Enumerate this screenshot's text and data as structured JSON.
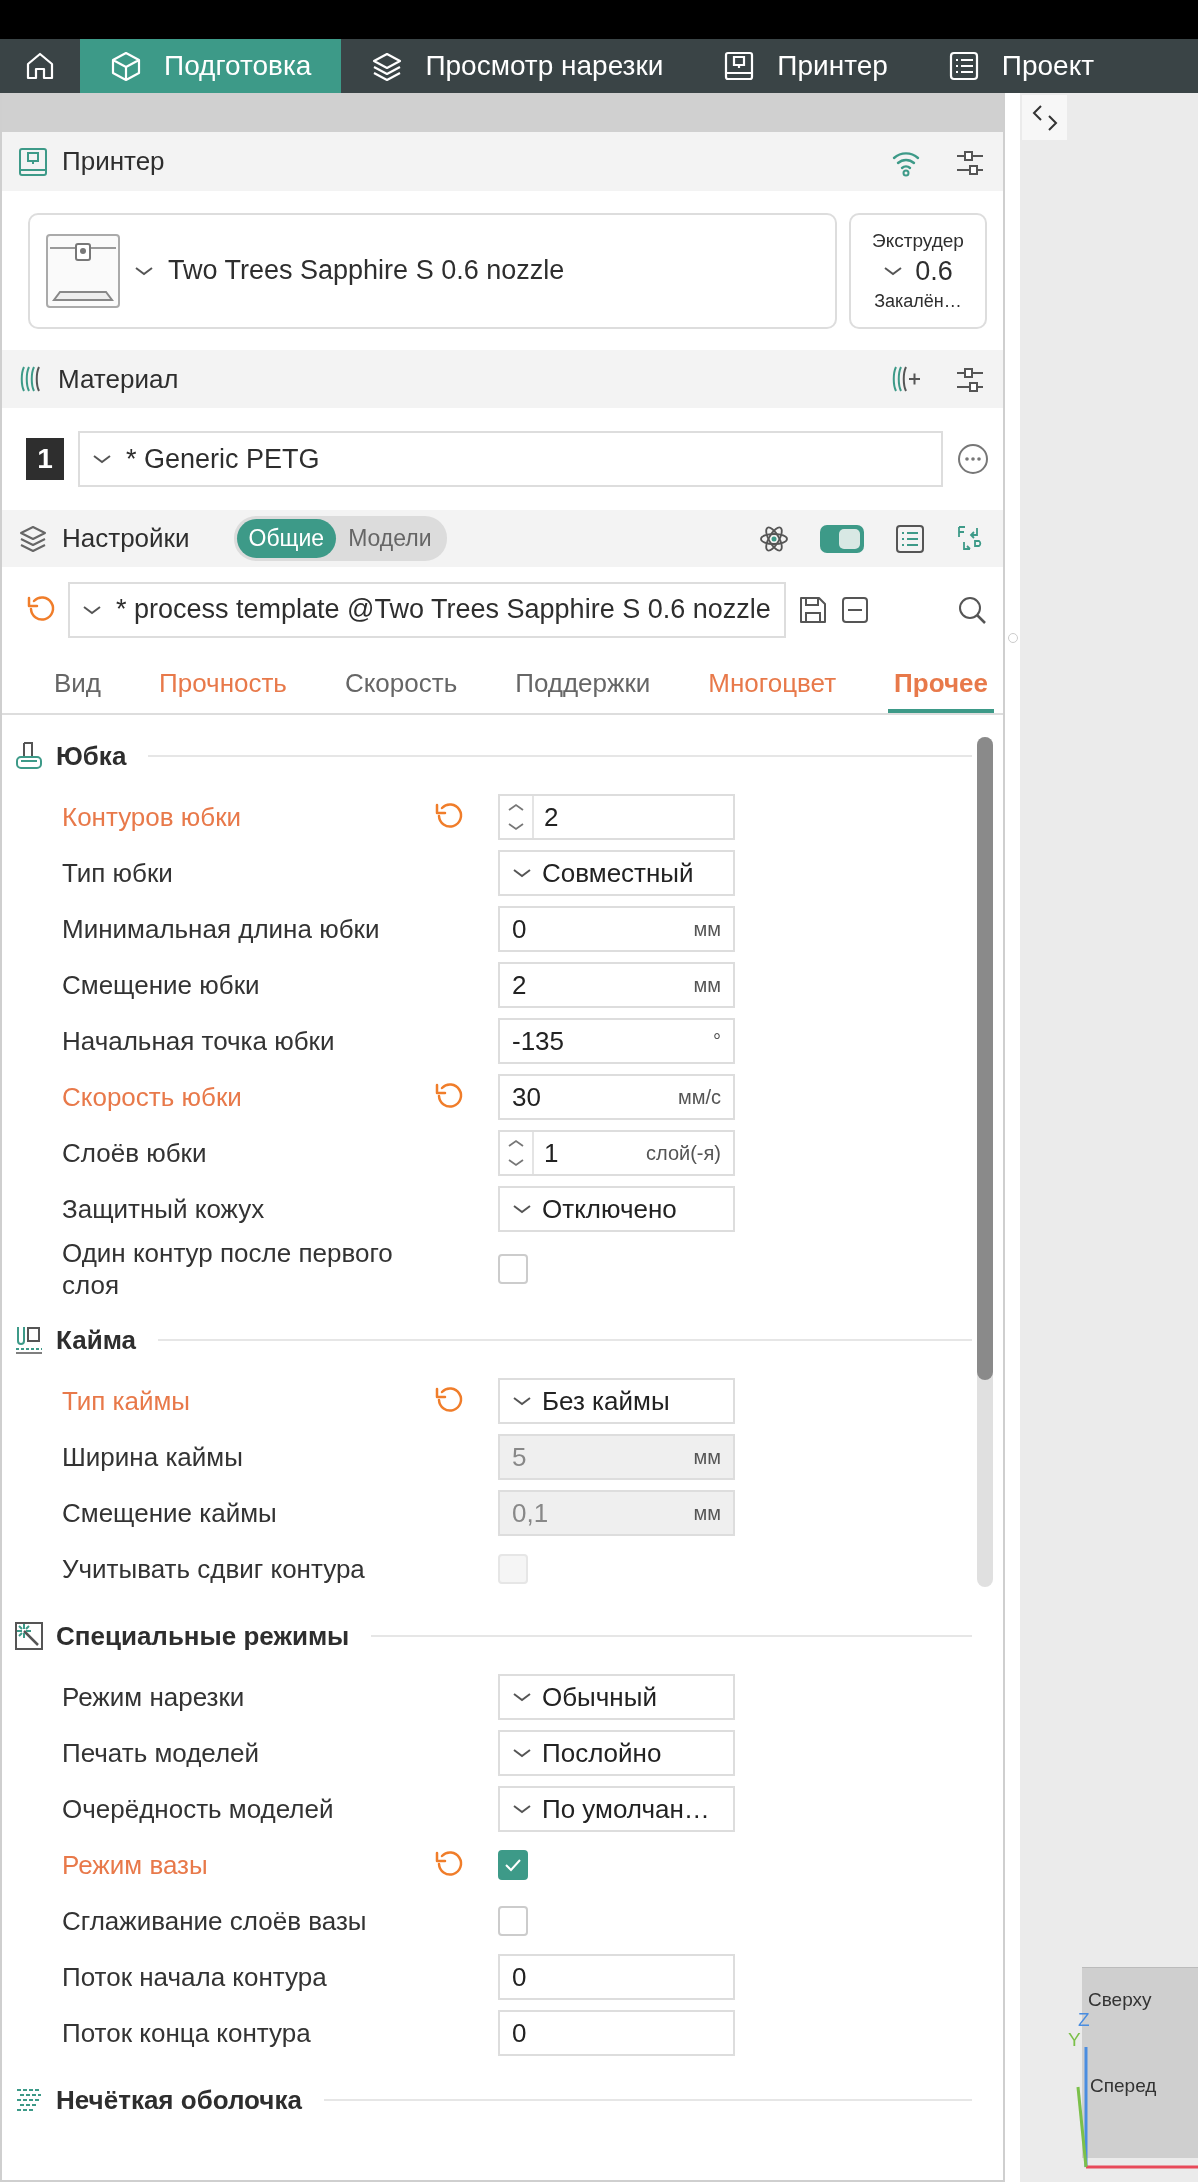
{
  "nav": {
    "tabs": [
      {
        "label": "Подготовка",
        "selected": true
      },
      {
        "label": "Просмотр нарезки",
        "selected": false
      },
      {
        "label": "Принтер",
        "selected": false
      },
      {
        "label": "Проект",
        "selected": false
      }
    ]
  },
  "printer": {
    "title": "Принтер",
    "name": "Two Trees Sapphire S 0.6 nozzle",
    "extruder": {
      "label": "Экструдер",
      "diameter": "0.6",
      "nozzle_type": "Закалён…"
    }
  },
  "material": {
    "title": "Материал",
    "filaments": [
      {
        "number": "1",
        "name": "* Generic PETG"
      }
    ]
  },
  "settings": {
    "title": "Настройки",
    "scope": [
      {
        "label": "Общие",
        "selected": true
      },
      {
        "label": "Модели",
        "selected": false
      }
    ],
    "advanced": true,
    "preset": {
      "name": "* process template @Two Trees Sapphire S 0.6 nozzle",
      "modified": true
    },
    "tabs": [
      {
        "label": "Вид",
        "selected": false,
        "modified": false
      },
      {
        "label": "Прочность",
        "selected": false,
        "modified": true
      },
      {
        "label": "Скорость",
        "selected": false,
        "modified": false
      },
      {
        "label": "Поддержки",
        "selected": false,
        "modified": false
      },
      {
        "label": "Многоцвет",
        "selected": false,
        "modified": true
      },
      {
        "label": "Прочее",
        "selected": true,
        "modified": true
      }
    ],
    "groups": [
      {
        "title": "Юбка",
        "options": [
          {
            "kind": "spinner",
            "label": "Контуров юбки",
            "value": "2",
            "modified": true,
            "disabled": false
          },
          {
            "kind": "dropdown",
            "label": "Тип юбки",
            "value": "Совместный",
            "modified": false,
            "disabled": false
          },
          {
            "kind": "input",
            "label": "Минимальная длина юбки",
            "value": "0",
            "unit": "мм",
            "modified": false,
            "disabled": false
          },
          {
            "kind": "input",
            "label": "Смещение юбки",
            "value": "2",
            "unit": "мм",
            "modified": false,
            "disabled": false
          },
          {
            "kind": "input",
            "label": "Начальная точка юбки",
            "value": "-135",
            "unit": "°",
            "modified": false,
            "disabled": false
          },
          {
            "kind": "input",
            "label": "Скорость юбки",
            "value": "30",
            "unit": "мм/с",
            "modified": true,
            "disabled": false
          },
          {
            "kind": "spinner",
            "label": "Слоёв юбки",
            "value": "1",
            "unit": "слой(-я)",
            "modified": false,
            "disabled": false
          },
          {
            "kind": "dropdown",
            "label": "Защитный кожух",
            "value": "Отключено",
            "modified": false,
            "disabled": false
          },
          {
            "kind": "checkbox",
            "label": "Один контур после первого слоя",
            "checked": false,
            "modified": false,
            "disabled": false
          }
        ]
      },
      {
        "title": "Кайма",
        "options": [
          {
            "kind": "dropdown",
            "label": "Тип каймы",
            "value": "Без каймы",
            "modified": true,
            "disabled": false
          },
          {
            "kind": "input",
            "label": "Ширина каймы",
            "value": "5",
            "unit": "мм",
            "modified": false,
            "disabled": true
          },
          {
            "kind": "input",
            "label": "Смещение каймы",
            "value": "0,1",
            "unit": "мм",
            "modified": false,
            "disabled": true
          },
          {
            "kind": "checkbox",
            "label": "Учитывать сдвиг контура",
            "checked": false,
            "modified": false,
            "disabled": true
          }
        ]
      },
      {
        "title": "Специальные режимы",
        "options": [
          {
            "kind": "dropdown",
            "label": "Режим нарезки",
            "value": "Обычный",
            "modified": false,
            "disabled": false
          },
          {
            "kind": "dropdown",
            "label": "Печать моделей",
            "value": "Послойно",
            "modified": false,
            "disabled": false
          },
          {
            "kind": "dropdown",
            "label": "Очерёдность моделей",
            "value": "По умолчан…",
            "modified": false,
            "disabled": false
          },
          {
            "kind": "checkbox",
            "label": "Режим вазы",
            "checked": true,
            "modified": true,
            "disabled": false
          },
          {
            "kind": "checkbox",
            "label": "Сглаживание слоёв вазы",
            "checked": false,
            "modified": false,
            "disabled": false
          },
          {
            "kind": "input",
            "label": "Поток начала контура",
            "value": "0",
            "modified": false,
            "disabled": false
          },
          {
            "kind": "input",
            "label": "Поток конца контура",
            "value": "0",
            "modified": false,
            "disabled": false
          }
        ]
      },
      {
        "title": "Нечёткая оболочка"
      }
    ]
  },
  "viewport": {
    "cube": {
      "top": "Сверху",
      "front": "Сперед",
      "axes": [
        "Z",
        "Y"
      ]
    }
  }
}
